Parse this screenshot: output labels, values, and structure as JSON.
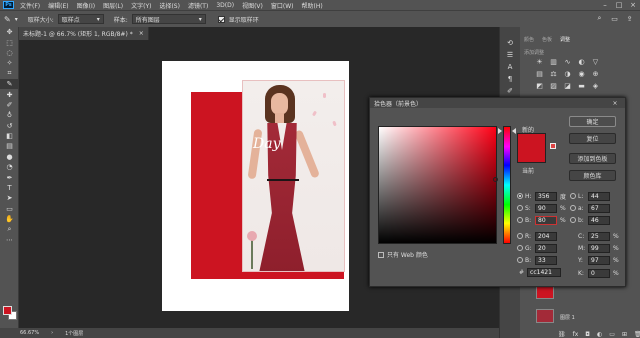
{
  "menubar": {
    "logo": "Ps",
    "items": [
      "文件(F)",
      "编辑(E)",
      "图像(I)",
      "图层(L)",
      "文字(Y)",
      "选择(S)",
      "滤镜(T)",
      "3D(D)",
      "视图(V)",
      "窗口(W)",
      "帮助(H)"
    ]
  },
  "options": {
    "sample_size_label": "取样大小:",
    "sample_size_value": "取样点",
    "sample_label": "样本:",
    "sample_value": "所有图层",
    "show_ring_label": "显示取样环"
  },
  "document": {
    "tab_title": "未标题-1 @ 66.7% (矩形 1, RGB/8#) *",
    "tab_close": "×",
    "canvas_script": "Day"
  },
  "status": {
    "zoom": "66.67%",
    "arrow": "›",
    "info": "1个图层"
  },
  "panels": {
    "tabs": [
      "颜色",
      "色板",
      "调整"
    ],
    "active_tab_index": 2,
    "adj_header": "添加调整",
    "layer_label": "图层 1"
  },
  "dialog": {
    "title": "拾色器（前景色）",
    "new_label": "新的",
    "current_label": "当前",
    "buttons": {
      "ok": "确定",
      "reset": "复位",
      "add_swatch": "添加到色板",
      "libraries": "颜色库"
    },
    "web_only": "只有 Web 颜色",
    "fields": {
      "H": {
        "label": "H:",
        "value": "356",
        "unit": "度"
      },
      "S": {
        "label": "S:",
        "value": "90",
        "unit": "%"
      },
      "B": {
        "label": "B:",
        "value": "80",
        "unit": "%"
      },
      "R": {
        "label": "R:",
        "value": "204"
      },
      "G": {
        "label": "G:",
        "value": "20"
      },
      "Bl": {
        "label": "B:",
        "value": "33"
      },
      "L": {
        "label": "L:",
        "value": "44"
      },
      "a": {
        "label": "a:",
        "value": "67"
      },
      "b": {
        "label": "b:",
        "value": "46"
      },
      "C": {
        "label": "C:",
        "value": "25",
        "unit": "%"
      },
      "M": {
        "label": "M:",
        "value": "99",
        "unit": "%"
      },
      "Y": {
        "label": "Y:",
        "value": "97",
        "unit": "%"
      },
      "K": {
        "label": "K:",
        "value": "0",
        "unit": "%"
      }
    },
    "hex_label": "#",
    "hex": "cc1421",
    "selected_color": "#cc1421"
  }
}
